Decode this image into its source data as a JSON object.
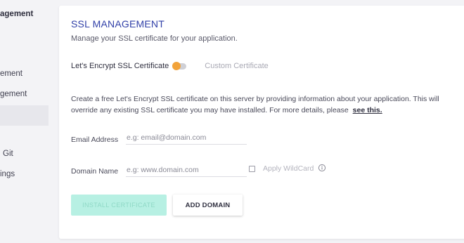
{
  "sidebar": {
    "items": [
      {
        "label": "agement"
      },
      {
        "label": "ement"
      },
      {
        "label": "gement"
      },
      {
        "label": ""
      },
      {
        "label": "Git"
      },
      {
        "label": "ings"
      }
    ]
  },
  "main": {
    "title": "SSL MANAGEMENT",
    "subtitle": "Manage your SSL certificate for your application.",
    "toggle": {
      "active_label": "Let's Encrypt SSL Certificate",
      "inactive_label": "Custom Certificate"
    },
    "description": "Create a free Let's Encrypt SSL certificate on this server by providing information about your application. This will override any existing SSL certificate you may have installed. For more details, please",
    "see_link": "see this.",
    "email": {
      "label": "Email Address",
      "placeholder": "e.g: email@domain.com"
    },
    "domain": {
      "label": "Domain Name",
      "placeholder": "e.g: www.domain.com"
    },
    "wildcard_label": "Apply WildCard",
    "buttons": {
      "install": "INSTALL CERTIFICATE",
      "add_domain": "ADD DOMAIN"
    }
  },
  "colors": {
    "accent": "#3140a8",
    "toggle_knob": "#f2a33a",
    "install_bg": "#b7f0e3"
  },
  "icons": {
    "info": "info-circle-icon"
  }
}
